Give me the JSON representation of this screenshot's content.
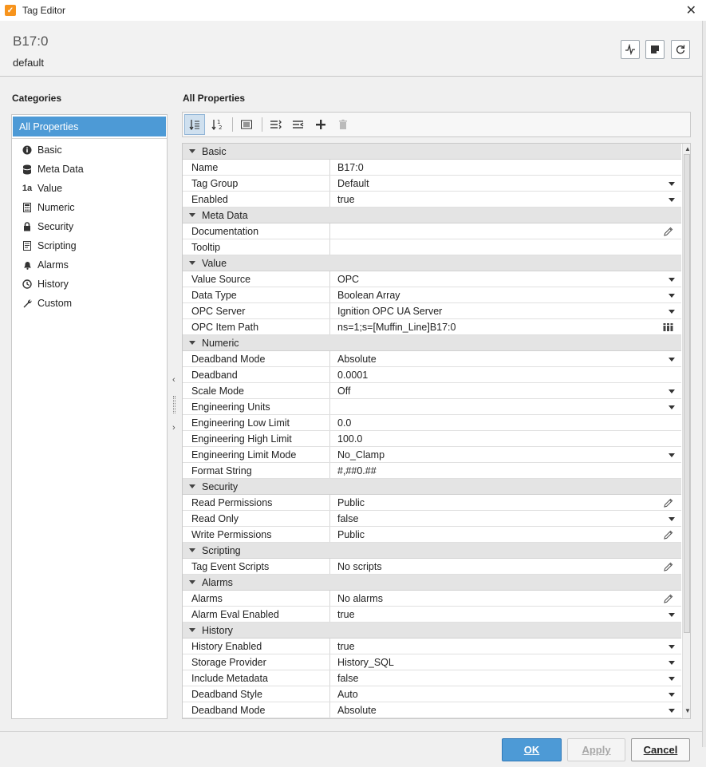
{
  "window": {
    "title": "Tag Editor",
    "app_icon_glyph": "✓"
  },
  "header": {
    "tag_name": "B17:0",
    "provider": "default"
  },
  "categories": {
    "title": "Categories",
    "items": [
      {
        "label": "All Properties",
        "icon": "none"
      },
      {
        "label": "Basic",
        "icon": "info-icon"
      },
      {
        "label": "Meta Data",
        "icon": "database-icon"
      },
      {
        "label": "Value",
        "icon": "value-icon"
      },
      {
        "label": "Numeric",
        "icon": "calculator-icon"
      },
      {
        "label": "Security",
        "icon": "lock-icon"
      },
      {
        "label": "Scripting",
        "icon": "script-icon"
      },
      {
        "label": "Alarms",
        "icon": "bell-icon"
      },
      {
        "label": "History",
        "icon": "clock-icon"
      },
      {
        "label": "Custom",
        "icon": "wrench-icon"
      }
    ]
  },
  "properties": {
    "title": "All Properties",
    "sections": [
      {
        "name": "Basic",
        "rows": [
          {
            "key": "Name",
            "value": "B17:0",
            "editor": "text"
          },
          {
            "key": "Tag Group",
            "value": "Default",
            "editor": "dropdown"
          },
          {
            "key": "Enabled",
            "value": "true",
            "editor": "dropdown"
          }
        ]
      },
      {
        "name": "Meta Data",
        "rows": [
          {
            "key": "Documentation",
            "value": "",
            "editor": "edit"
          },
          {
            "key": "Tooltip",
            "value": "",
            "editor": "text"
          }
        ]
      },
      {
        "name": "Value",
        "rows": [
          {
            "key": "Value Source",
            "value": "OPC",
            "editor": "dropdown"
          },
          {
            "key": "Data Type",
            "value": "Boolean Array",
            "editor": "dropdown"
          },
          {
            "key": "OPC Server",
            "value": "Ignition OPC UA Server",
            "editor": "dropdown"
          },
          {
            "key": "OPC Item Path",
            "value": "ns=1;s=[Muffin_Line]B17:0",
            "editor": "browse"
          }
        ]
      },
      {
        "name": "Numeric",
        "rows": [
          {
            "key": "Deadband Mode",
            "value": "Absolute",
            "editor": "dropdown"
          },
          {
            "key": "Deadband",
            "value": "0.0001",
            "editor": "text"
          },
          {
            "key": "Scale Mode",
            "value": "Off",
            "editor": "dropdown"
          },
          {
            "key": "Engineering Units",
            "value": "",
            "editor": "dropdown"
          },
          {
            "key": "Engineering Low Limit",
            "value": "0.0",
            "editor": "text"
          },
          {
            "key": "Engineering High Limit",
            "value": "100.0",
            "editor": "text"
          },
          {
            "key": "Engineering Limit Mode",
            "value": "No_Clamp",
            "editor": "dropdown"
          },
          {
            "key": "Format String",
            "value": "#,##0.##",
            "editor": "text"
          }
        ]
      },
      {
        "name": "Security",
        "rows": [
          {
            "key": "Read Permissions",
            "value": "Public",
            "editor": "edit"
          },
          {
            "key": "Read Only",
            "value": "false",
            "editor": "dropdown"
          },
          {
            "key": "Write Permissions",
            "value": "Public",
            "editor": "edit"
          }
        ]
      },
      {
        "name": "Scripting",
        "rows": [
          {
            "key": "Tag Event Scripts",
            "value": "No scripts",
            "editor": "edit"
          }
        ]
      },
      {
        "name": "Alarms",
        "rows": [
          {
            "key": "Alarms",
            "value": "No alarms",
            "editor": "edit"
          },
          {
            "key": "Alarm Eval Enabled",
            "value": "true",
            "editor": "dropdown"
          }
        ]
      },
      {
        "name": "History",
        "rows": [
          {
            "key": "History Enabled",
            "value": "true",
            "editor": "dropdown"
          },
          {
            "key": "Storage Provider",
            "value": "History_SQL",
            "editor": "dropdown"
          },
          {
            "key": "Include Metadata",
            "value": "false",
            "editor": "dropdown"
          },
          {
            "key": "Deadband Style",
            "value": "Auto",
            "editor": "dropdown"
          },
          {
            "key": "Deadband Mode",
            "value": "Absolute",
            "editor": "dropdown"
          }
        ]
      }
    ]
  },
  "footer": {
    "ok": "OK",
    "apply": "Apply",
    "cancel": "Cancel"
  },
  "colors": {
    "accent": "#4d9ad6",
    "category_row_bg": "#e4e4e4",
    "app_icon": "#f7941d"
  }
}
